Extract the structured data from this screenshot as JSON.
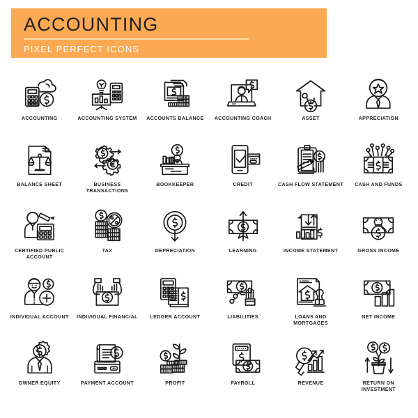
{
  "header": {
    "title": "ACCOUNTING",
    "subtitle": "PIXEL PERFECT ICONS",
    "banner_color": "#fca954",
    "rule_color": "#ffe0ae",
    "title_color": "#231f20",
    "subtitle_color": "#ffffff"
  },
  "canvas": {
    "background": "#ffffff",
    "icon_stroke_color": "#1a1a1a",
    "columns": 6,
    "rows": 5,
    "total_icons": 30
  },
  "icons": [
    {
      "label": "ACCOUNTING",
      "icon": "calculator-cloud-coin-icon"
    },
    {
      "label": "ACCOUNTING SYSTEM",
      "icon": "presentation-lightbulb-calculator-icon"
    },
    {
      "label": "ACCOUNTS BALANCE",
      "icon": "document-dollar-coin-stacks-icon"
    },
    {
      "label": "ACCOUNTING COACH",
      "icon": "laptop-person-dollar-bubble-icon"
    },
    {
      "label": "ASSET",
      "icon": "house-money-bag-icon"
    },
    {
      "label": "APPRECIATION",
      "icon": "businessman-star-icon"
    },
    {
      "label": "BALANCE SHEET",
      "icon": "document-scales-icon"
    },
    {
      "label": "BUSINESS TRANSACTIONS",
      "icon": "gears-dollar-euro-arrows-icon"
    },
    {
      "label": "BOOKKEEPER",
      "icon": "desk-clerk-dollar-books-icon"
    },
    {
      "label": "CREDIT",
      "icon": "smartphone-check-credit-card-icon"
    },
    {
      "label": "CASH FLOW STATEMENT",
      "icon": "clipboard-pencil-dollar-chart-icon"
    },
    {
      "label": "CASH AND FUNDS",
      "icon": "banknote-sparkles-icon"
    },
    {
      "label": "CERTIFIED PUBLIC ACCOUNT",
      "icon": "accountant-pencil-calculator-icon"
    },
    {
      "label": "TAX",
      "icon": "coin-stacks-percent-dollar-icon"
    },
    {
      "label": "DEPRECIATION",
      "icon": "dollar-coin-down-arrow-icon"
    },
    {
      "label": "LEARNING",
      "icon": "banknote-arrow-up-icon"
    },
    {
      "label": "INCOME STATEMENT",
      "icon": "document-bar-chart-arrows-dollar-icon"
    },
    {
      "label": "GROSS INCOME",
      "icon": "banknote-money-bag-icon"
    },
    {
      "label": "INDIVIDUAL ACCOUNT",
      "icon": "person-dollar-plus-icon"
    },
    {
      "label": "INDIVIDUAL FINANCIAL",
      "icon": "hands-holding-dollar-box-icon"
    },
    {
      "label": "LEDGER ACCOUNT",
      "icon": "calculator-ledger-book-dollar-icon"
    },
    {
      "label": "LIABILITIES",
      "icon": "hand-chained-to-money-icon"
    },
    {
      "label": "LOANS AND MORTGAGES",
      "icon": "mortgage-document-stamp-icon"
    },
    {
      "label": "NET INCOME",
      "icon": "banknote-bar-chart-icon"
    },
    {
      "label": "OWNER EQUITY",
      "icon": "businessman-gear-dollar-head-icon"
    },
    {
      "label": "PAYMENT ACCOUNT",
      "icon": "receipt-credit-card-dollar-icon"
    },
    {
      "label": "PROFIT",
      "icon": "coin-stacks-plant-icon"
    },
    {
      "label": "PAYROLL",
      "icon": "payroll-machine-banknote-icon"
    },
    {
      "label": "REVENUE",
      "icon": "magnifier-dollar-growth-chart-icon"
    },
    {
      "label": "RETURN ON INVESTMENT",
      "icon": "potted-plant-dollar-coins-icon"
    }
  ]
}
